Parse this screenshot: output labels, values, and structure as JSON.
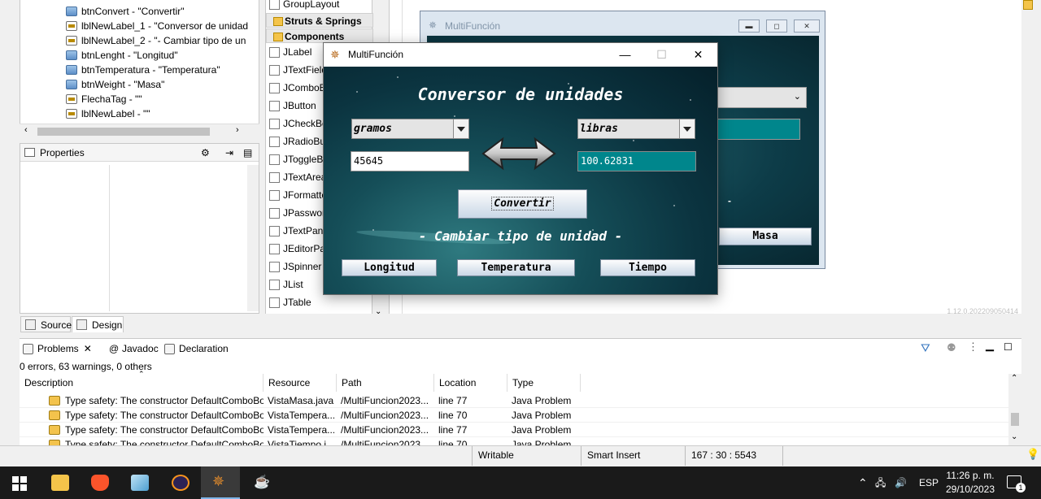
{
  "tree": {
    "items": [
      {
        "label": "btnConvert - \"Convertir\"",
        "kind": "button"
      },
      {
        "label": "lblNewLabel_1 - \"Conversor de unidad",
        "kind": "label"
      },
      {
        "label": "lblNewLabel_2 - \"- Cambiar tipo de un",
        "kind": "label"
      },
      {
        "label": "btnLenght - \"Longitud\"",
        "kind": "button"
      },
      {
        "label": "btnTemperatura - \"Temperatura\"",
        "kind": "button"
      },
      {
        "label": "btnWeight - \"Masa\"",
        "kind": "button"
      },
      {
        "label": "FlechaTag - \"\"",
        "kind": "label"
      },
      {
        "label": "lblNewLabel - \"\"",
        "kind": "label"
      }
    ]
  },
  "properties": {
    "title": "Properties"
  },
  "palette": {
    "top_item": "GroupLayout",
    "categories": [
      "Struts & Springs",
      "Components"
    ],
    "items": [
      "JLabel",
      "JTextField",
      "JComboBox",
      "JButton",
      "JCheckBox",
      "JRadioButton",
      "JToggleButton",
      "JTextArea",
      "JFormattedTextField",
      "JPasswordField",
      "JTextPane",
      "JEditorPane",
      "JSpinner",
      "JList",
      "JTable"
    ]
  },
  "bg_window": {
    "title": "MultiFunción",
    "mass_button": "Masa",
    "dash": "-"
  },
  "editor_tabs": {
    "source": "Source",
    "design": "Design"
  },
  "version_text": "1.12.0.202209050414",
  "bottom": {
    "tabs": {
      "problems": "Problems",
      "javadoc": "Javadoc",
      "declaration": "Declaration"
    },
    "summary": "0 errors, 63 warnings, 0 others",
    "columns": [
      "Description",
      "Resource",
      "Path",
      "Location",
      "Type"
    ],
    "rows": [
      {
        "description": "Type safety: The constructor DefaultComboBo",
        "resource": "VistaMasa.java",
        "path": "/MultiFuncion2023...",
        "location": "line 77",
        "type": "Java Problem"
      },
      {
        "description": "Type safety: The constructor DefaultComboBo",
        "resource": "VistaTempera...",
        "path": "/MultiFuncion2023...",
        "location": "line 70",
        "type": "Java Problem"
      },
      {
        "description": "Type safety: The constructor DefaultComboBo",
        "resource": "VistaTempera...",
        "path": "/MultiFuncion2023...",
        "location": "line 77",
        "type": "Java Problem"
      },
      {
        "description": "Type safety: The constructor DefaultComboBo",
        "resource": "VistaTiempo.j...",
        "path": "/MultiFuncion2023...",
        "location": "line 70",
        "type": "Java Problem"
      }
    ]
  },
  "status": {
    "writable": "Writable",
    "insert": "Smart Insert",
    "position": "167 : 30 : 5543"
  },
  "app": {
    "title": "MultiFunción",
    "heading": "Conversor de unidades",
    "from_unit": "gramos",
    "to_unit": "libras",
    "input_value": "45645",
    "output_value": "100.62831",
    "convert_label": "Convertir",
    "subheading": "- Cambiar tipo de unidad -",
    "buttons": {
      "length": "Longitud",
      "temperature": "Temperatura",
      "time": "Tiempo"
    }
  },
  "taskbar": {
    "language": "ESP",
    "time": "11:26 p. m.",
    "date": "29/10/2023",
    "notifications": "1"
  },
  "colors": {
    "output_bg": "#00868c",
    "accent": "#7fb5e8"
  }
}
